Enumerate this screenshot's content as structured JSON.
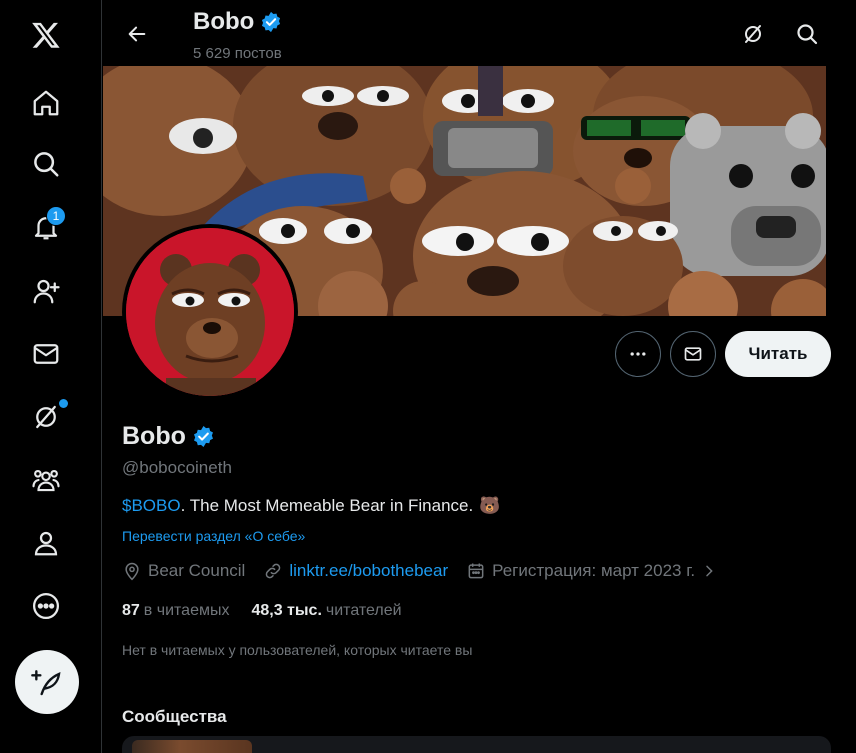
{
  "colors": {
    "accent": "#1d9bf0",
    "background": "#000000",
    "muted": "#71767b",
    "text": "#e7e9ea"
  },
  "nav": {
    "items": [
      {
        "icon": "x-logo-icon"
      },
      {
        "icon": "home-icon"
      },
      {
        "icon": "search-icon"
      },
      {
        "icon": "notifications-bell-icon",
        "badge": "1"
      },
      {
        "icon": "follow-user-icon"
      },
      {
        "icon": "mail-icon"
      },
      {
        "icon": "grok-icon"
      },
      {
        "icon": "communities-icon"
      },
      {
        "icon": "profile-icon"
      },
      {
        "icon": "more-circle-icon"
      }
    ],
    "compose_icon": "compose-post-icon"
  },
  "header": {
    "name": "Bobo",
    "posts_count": "5 629 постов"
  },
  "profile": {
    "name": "Bobo",
    "handle": "@bobocoineth",
    "bio_cashtag": "$BOBO",
    "bio_text": ". The Most Memeable Bear in Finance.",
    "bio_emoji": "🐻",
    "translate_link": "Перевести раздел «О себе»",
    "location": "Bear Council",
    "website": "linktr.ee/bobothebear",
    "joined": "Регистрация: март 2023 г.",
    "following_count": "87",
    "following_label": "в читаемых",
    "followers_count": "48,3 тыс.",
    "followers_label": "читателей",
    "followed_by_note": "Нет в читаемых у пользователей, которых читаете вы",
    "follow_button": "Читать",
    "communities_heading": "Сообщества"
  }
}
